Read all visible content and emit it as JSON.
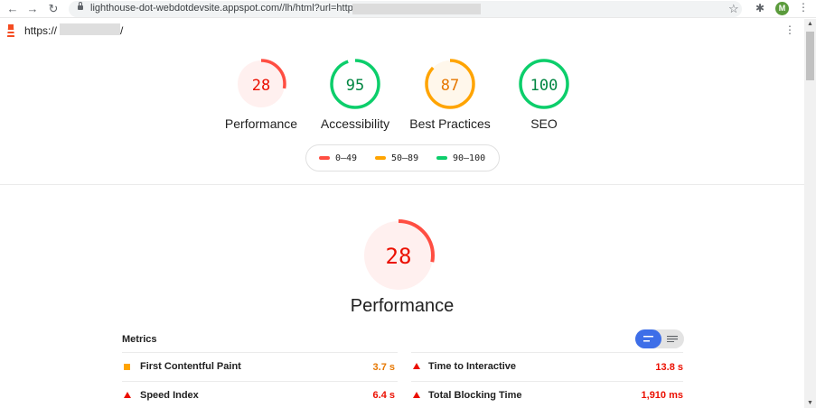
{
  "browser": {
    "url": "lighthouse-dot-webdotdevsite.appspot.com//lh/html?url=https%3/",
    "avatar_letter": "M"
  },
  "report": {
    "url_prefix": "https://",
    "url_suffix": "/"
  },
  "categories": [
    {
      "name": "Performance",
      "score": 28,
      "color": "#ff4e42",
      "fill": "#fff0ef"
    },
    {
      "name": "Accessibility",
      "score": 95,
      "color": "#0cce6b",
      "fill": "#ffffff"
    },
    {
      "name": "Best Practices",
      "score": 87,
      "color": "#ffa400",
      "fill": "#fff7eb"
    },
    {
      "name": "SEO",
      "score": 100,
      "color": "#0cce6b",
      "fill": "#ffffff"
    }
  ],
  "legend": [
    {
      "range": "0–49",
      "color": "#ff4e42"
    },
    {
      "range": "50–89",
      "color": "#ffa400"
    },
    {
      "range": "90–100",
      "color": "#0cce6b"
    }
  ],
  "main": {
    "title": "Performance",
    "score": 28,
    "metrics_heading": "Metrics"
  },
  "metrics": {
    "left": [
      {
        "name": "First Contentful Paint",
        "value": "3.7 s",
        "status": "average",
        "color": "#e67700"
      },
      {
        "name": "Speed Index",
        "value": "6.4 s",
        "status": "fail",
        "color": "#eb0f00"
      }
    ],
    "right": [
      {
        "name": "Time to Interactive",
        "value": "13.8 s",
        "status": "fail",
        "color": "#eb0f00"
      },
      {
        "name": "Total Blocking Time",
        "value": "1,910 ms",
        "status": "fail",
        "color": "#eb0f00"
      }
    ]
  }
}
